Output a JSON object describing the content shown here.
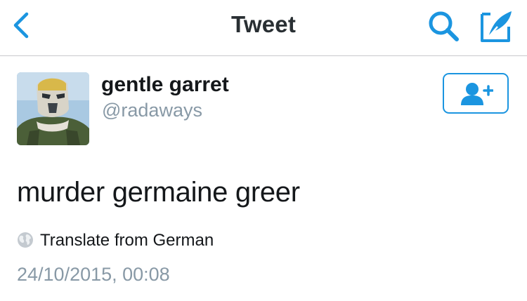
{
  "colors": {
    "accent": "#1b95e0",
    "text_primary": "#14171a",
    "text_secondary": "#8899a6",
    "divider": "#c8c8cc"
  },
  "navbar": {
    "title": "Tweet",
    "back_icon": "chevron-left-icon",
    "search_icon": "search-icon",
    "compose_icon": "compose-tweet-icon"
  },
  "tweet": {
    "author": {
      "display_name": "gentle garret",
      "handle": "@radaways",
      "avatar_icon": "avatar"
    },
    "follow_icon": "add-user-icon",
    "text": "murder germaine greer",
    "translate_label": "Translate from German",
    "translate_icon": "globe-icon",
    "timestamp": "24/10/2015, 00:08"
  }
}
